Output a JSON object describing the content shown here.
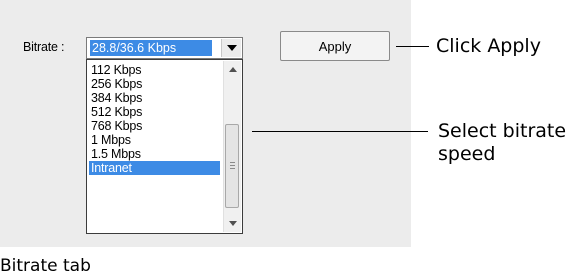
{
  "bitrate": {
    "label": "Bitrate :",
    "selected_value": "28.8/36.6 Kbps",
    "apply_label": "Apply",
    "options": [
      "112 Kbps",
      "256 Kbps",
      "384 Kbps",
      "512 Kbps",
      "768 Kbps",
      "1 Mbps",
      "1.5 Mbps",
      "Intranet"
    ],
    "highlighted_option": "Intranet"
  },
  "callouts": {
    "apply": "Click Apply",
    "select_line1": "Select bitrate",
    "select_line2": "speed"
  },
  "caption": "Bitrate tab",
  "colors": {
    "selection": "#3d8be5",
    "panel": "#ececec"
  }
}
